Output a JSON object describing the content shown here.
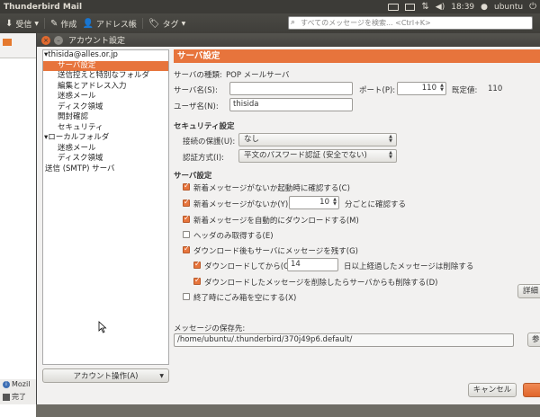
{
  "app": {
    "title": "Thunderbird Mail",
    "clock": "18:39",
    "user": "ubuntu"
  },
  "toolbar": {
    "receive": "受信",
    "compose": "作成",
    "addressbook": "アドレス帳",
    "tag": "タグ",
    "search_placeholder": "すべてのメッセージを検索... <Ctrl+K>"
  },
  "statusbar": {
    "mozilla": "Mozil",
    "done": "完了"
  },
  "dialog": {
    "title": "アカウント設定",
    "tree": [
      {
        "label": "thisida@alles.or.jp",
        "level": 0,
        "expanded": true
      },
      {
        "label": "サーバ設定",
        "level": 1,
        "selected": true
      },
      {
        "label": "送信控えと特別なフォルダ",
        "level": 1
      },
      {
        "label": "編集とアドレス入力",
        "level": 1
      },
      {
        "label": "迷惑メール",
        "level": 1
      },
      {
        "label": "ディスク領域",
        "level": 1
      },
      {
        "label": "開封確認",
        "level": 1
      },
      {
        "label": "セキュリティ",
        "level": 1
      },
      {
        "label": "ローカルフォルダ",
        "level": 0,
        "expanded": true
      },
      {
        "label": "迷惑メール",
        "level": 1
      },
      {
        "label": "ディスク領域",
        "level": 1
      },
      {
        "label": "送信 (SMTP) サーバ",
        "level": 0
      }
    ],
    "account_actions": "アカウント操作(A)",
    "cancel": "キャンセル"
  },
  "server": {
    "header": "サーバ設定",
    "type_label": "サーバの種類:",
    "type_value": "POP メールサーバ",
    "name_label": "サーバ名(S):",
    "name_value": "",
    "port_label": "ポート(P):",
    "port_value": "110",
    "default_label": "既定値:",
    "default_value": "110",
    "user_label": "ユーザ名(N):",
    "user_value": "thisida",
    "security_heading": "セキュリティ設定",
    "conn_label": "接続の保護(U):",
    "conn_value": "なし",
    "auth_label": "認証方式(I):",
    "auth_value": "平文のパスワード認証 (安全でない)",
    "server_heading": "サーバ設定",
    "opt_startup": "新着メッセージがないか起動時に確認する(C)",
    "opt_every": "新着メッセージがないか(Y)",
    "opt_every_value": "10",
    "opt_every_suffix": "分ごとに確認する",
    "opt_autodl": "新着メッセージを自動的にダウンロードする(M)",
    "opt_headers": "ヘッダのみ取得する(E)",
    "opt_leave": "ダウンロード後もサーバにメッセージを残す(G)",
    "opt_delete_prefix": "ダウンロードしてから(O)",
    "opt_delete_days": "14",
    "opt_delete_suffix": "日以上経過したメッセージは削除する",
    "opt_delete_sync": "ダウンロードしたメッセージを削除したらサーバからも削除する(D)",
    "opt_empty_trash": "終了時にごみ箱を空にする(X)",
    "advanced": "詳細",
    "storage_label": "メッセージの保存先:",
    "storage_path": "/home/ubuntu/.thunderbird/370j49p6.default/",
    "browse": "参照"
  },
  "checks": {
    "opt_startup": true,
    "opt_every": true,
    "opt_autodl": true,
    "opt_headers": false,
    "opt_leave": true,
    "opt_delete": true,
    "opt_delete_sync": true,
    "opt_empty_trash": false
  },
  "colors": {
    "accent": "#e7743c",
    "panel_bg": "#f2f1f0",
    "topbar": "#3c3b37"
  }
}
